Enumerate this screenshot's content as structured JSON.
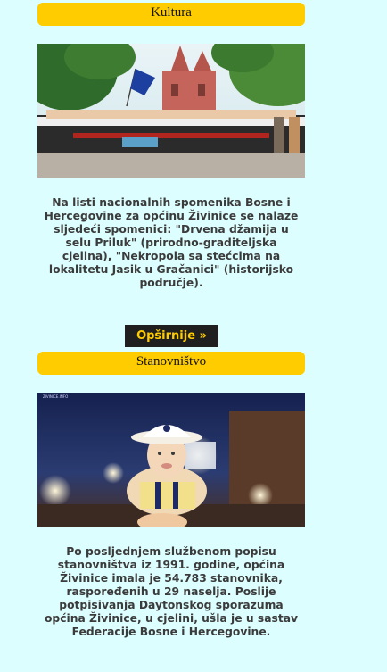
{
  "sections": [
    {
      "title": "Kultura",
      "image_alt": "Folklorna grupa ispred crkve sa zastavom",
      "text": "Na listi nacionalnih spomenika Bosne i Hercegovine za općinu Živinice se nalaze sljedeći spomenici: \"Drvena džamija u selu Priluk\" (prirodno-graditeljska cjelina), \"Nekropola sa stećcima na lokalitetu Jasik u Gračanici\" (historijsko područje).",
      "more_label": "Opširnije »"
    },
    {
      "title": "Stanovništvo",
      "image_alt": "Dijete s kapom na ramenima",
      "watermark": "ZIVINICE.INFO",
      "text": "Po posljednjem službenom popisu stanovništva iz 1991. godine, općina Živinice imala je 54.783 stanovnika, raspoređenih u 29 naselja. Poslije potpisivanja Daytonskog sporazuma općina Živinice, u cjelini, ušla je u sastav Federacije Bosne i Hercegovine."
    }
  ],
  "colors": {
    "background": "#ddfeff",
    "title_bar": "#ffcc00",
    "button_bg": "#1f1f1f",
    "button_text": "#ffcc00",
    "body_text": "#3b3b3b"
  }
}
